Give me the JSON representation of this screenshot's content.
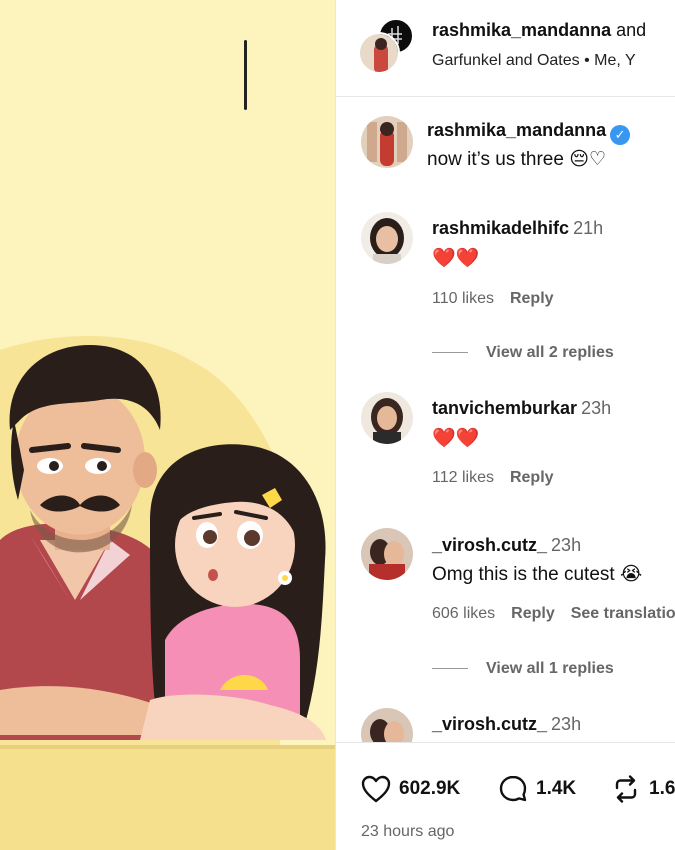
{
  "header": {
    "username": "rashmika_mandanna",
    "and_text": " and",
    "subtitle": "Garfunkel and Oates • Me, Y"
  },
  "caption": {
    "username": "rashmika_mandanna",
    "verified_icon": "check-icon",
    "text": "now it’s us three 😔♡"
  },
  "comments": [
    {
      "username": "rashmikadelhifc",
      "time": "21h",
      "text": "❤️❤️",
      "likes": "110 likes",
      "reply": "Reply",
      "view_replies": "View all 2 replies"
    },
    {
      "username": "tanvichemburkar",
      "time": "23h",
      "text": "❤️❤️",
      "likes": "112 likes",
      "reply": "Reply"
    },
    {
      "username": "_virosh.cutz_",
      "time": "23h",
      "text": "Omg this is the cutest 😭",
      "likes": "606 likes",
      "reply": "Reply",
      "translation": "See translation",
      "view_replies": "View all 1 replies"
    },
    {
      "username": "_virosh.cutz_",
      "time": "23h"
    }
  ],
  "actions": {
    "likes_count": "602.9K",
    "comments_count": "1.4K",
    "reposts_count": "1.6",
    "time_ago": "23 hours ago",
    "like_icon": "heart-icon",
    "comment_icon": "comment-icon",
    "repost_icon": "repost-icon"
  },
  "colors": {
    "media_background": "#fdf3bd",
    "verified": "#3897f0",
    "heart": "#e0243a"
  }
}
